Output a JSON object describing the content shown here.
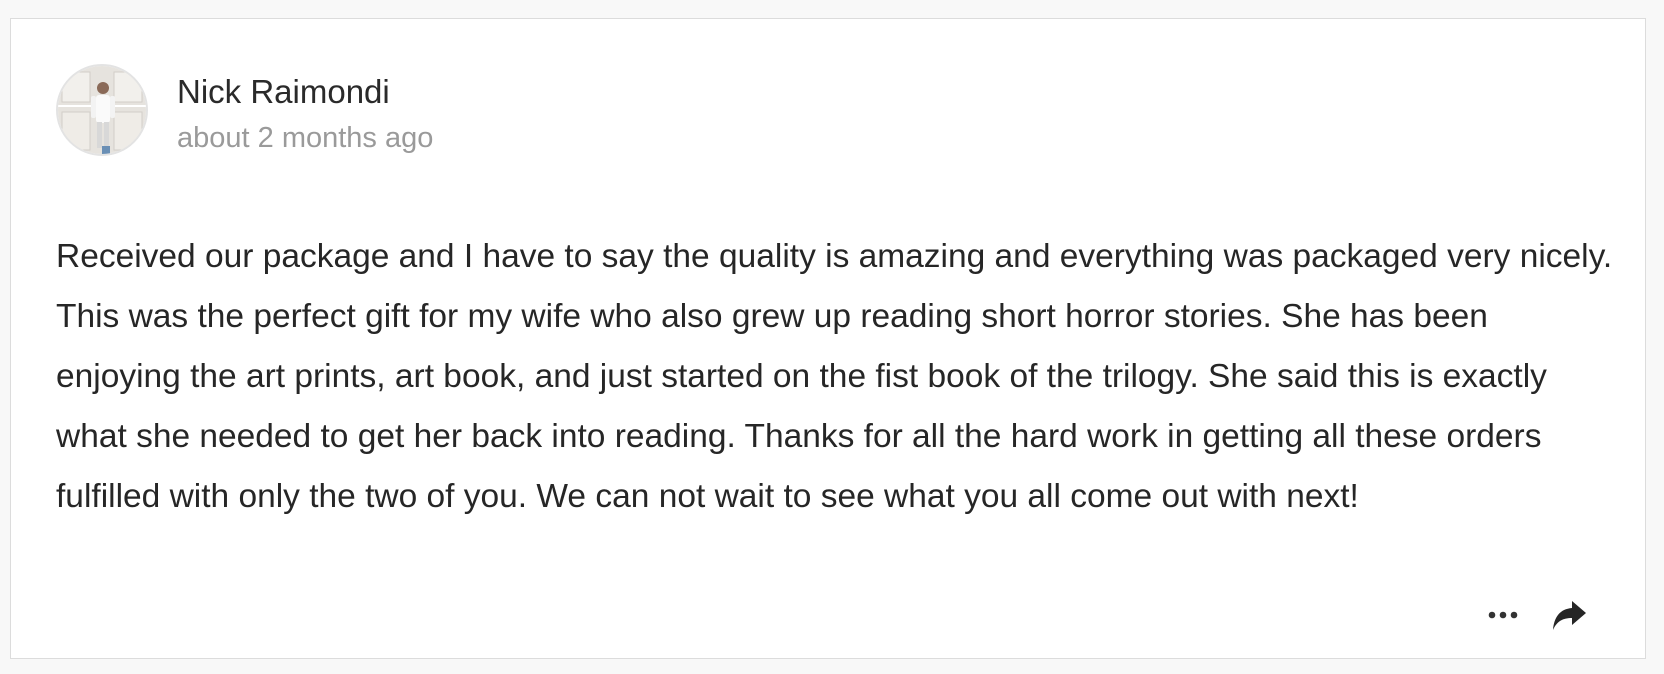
{
  "review": {
    "author_name": "Nick Raimondi",
    "timestamp": "about 2 months ago",
    "body": "Received our package and I have to say the quality is amazing and everything was packaged very nicely. This was the perfect gift for my wife who also grew up reading short horror stories. She has been enjoying the art prints, art book, and just started on the fist book of the trilogy. She said this is exactly what she needed to get her back into reading. Thanks for all the hard work in getting all these orders fulfilled with only the two of you. We can not wait to see what you all come out with next!"
  },
  "actions": {
    "more_icon": "more-horizontal-icon",
    "share_icon": "share-arrow-icon"
  },
  "colors": {
    "text": "#262626",
    "muted": "#9a9a9a",
    "border": "#dcdcdc",
    "background": "#f8f8f8",
    "card": "#ffffff"
  }
}
